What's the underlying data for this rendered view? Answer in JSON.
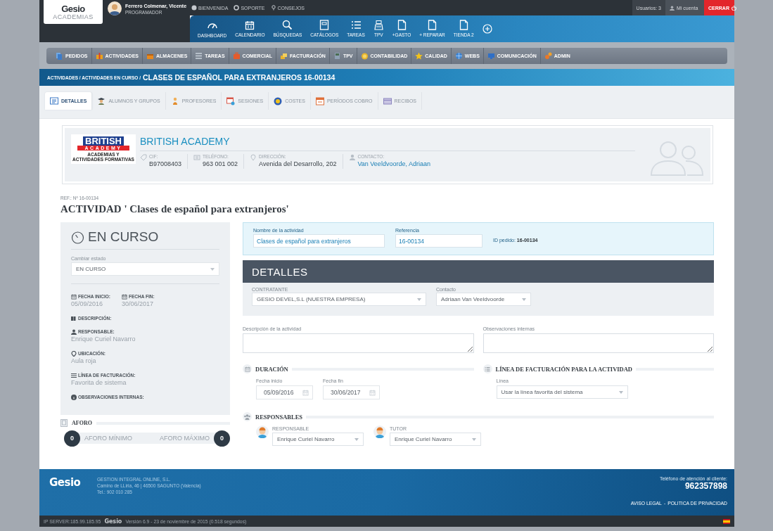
{
  "header": {
    "logo_text": "Gesio",
    "logo_sub": "ACADEMIAS",
    "user_name": "Ferrero Colmenar, Vicente",
    "user_role": "PROGRAMADOR",
    "top_links": [
      "BIENVENIDA",
      "SOPORTE",
      "CONSEJOS"
    ],
    "users": "Usuarios: 3",
    "account": "Mi cuenta",
    "logout": "CERRAR"
  },
  "toolbar": [
    {
      "label": "DASHBOARD"
    },
    {
      "label": "CALENDARIO"
    },
    {
      "label": "BÚSQUEDAS"
    },
    {
      "label": "CATÁLOGOS"
    },
    {
      "label": "TAREAS"
    },
    {
      "label": "TPV"
    },
    {
      "label": "+GASTO"
    },
    {
      "label": "+ REPARAR"
    },
    {
      "label": "TIENDA 2"
    }
  ],
  "menu": [
    {
      "label": "PEDIDOS"
    },
    {
      "label": "ACTIVIDADES"
    },
    {
      "label": "ALMACENES"
    },
    {
      "label": "TAREAS"
    },
    {
      "label": "COMERCIAL"
    },
    {
      "label": "FACTURACIÓN"
    },
    {
      "label": "TPV"
    },
    {
      "label": "CONTABILIDAD"
    },
    {
      "label": "CALIDAD"
    },
    {
      "label": "WEBS"
    },
    {
      "label": "COMUNICACIÓN"
    },
    {
      "label": "ADMIN"
    }
  ],
  "breadcrumb": {
    "path": "ACTIVIDADES / ACTIVIDADES EN CURSO /",
    "current": "CLASES DE ESPAÑOL PARA EXTRANJEROS 16-00134"
  },
  "tabs": [
    {
      "label": "DETALLES",
      "selected": true
    },
    {
      "label": "ALUMNOS Y GRUPOS",
      "selected": false
    },
    {
      "label": "PROFESORES",
      "selected": false
    },
    {
      "label": "SESIONES",
      "selected": false
    },
    {
      "label": "COSTES",
      "selected": false
    },
    {
      "label": "PERÍODOS COBRO",
      "selected": false
    },
    {
      "label": "RECIBOS",
      "selected": false
    }
  ],
  "company": {
    "logo_line1": "BRITISH",
    "logo_line2": "ACADEMY",
    "logo_tagline": "ACADEMIAS Y ACTIVIDADES FORMATIVAS",
    "name": "BRITISH ACADEMY",
    "fields": [
      {
        "label": "CIF:",
        "value": "B97008403",
        "kind": "text"
      },
      {
        "label": "TELÉFONO:",
        "value": "963 001 002",
        "kind": "text"
      },
      {
        "label": "DIRECCIÓN:",
        "value": "Avenida del Desarrollo, 202",
        "kind": "text"
      },
      {
        "label": "CONTACTO:",
        "value": "Van Veeldvoorde, Adriaan",
        "kind": "link"
      }
    ]
  },
  "activity": {
    "ref": "REF.: Nº 16-00134",
    "title": "ACTIVIDAD ' Clases de español para extranjeros'"
  },
  "status_panel": {
    "status": "EN CURSO",
    "change_label": "Cambiar estado",
    "change_value": "EN CURSO",
    "dates": [
      {
        "label": "FECHA INICIO:",
        "value": "05/09/2016"
      },
      {
        "label": "FECHA FIN:",
        "value": "30/06/2017"
      }
    ],
    "details": [
      {
        "label": "DESCRIPCIÓN:"
      },
      {
        "label": "RESPONSABLE:",
        "value": "Enrique Curiel Navarro"
      },
      {
        "label": "UBICACIÓN:",
        "value": "Aula roja"
      },
      {
        "label": "LÍNEA DE FACTURACIÓN:",
        "value": "Favorita de sistema"
      },
      {
        "label": "OBSERVACIONES INTERNAS:"
      }
    ]
  },
  "aforo": {
    "title": "AFORO",
    "min_value": "0",
    "min_label": "AFORO MÍNIMO",
    "max_label": "AFORO MÁXIMO",
    "max_value": "0"
  },
  "main_fields": {
    "name_label": "Nombre de la actividad",
    "name_value": "Clases de español para extranjeros",
    "ref_label": "Referencia",
    "ref_value": "16-00134",
    "id_label": "ID pedido:",
    "id_value": "16-00134"
  },
  "detalles": {
    "title": "DETALLES",
    "contratante_label": "CONTRATANTE",
    "contratante_value": "GESIO DEVEL,S.L (NUESTRA EMPRESA)",
    "contacto_label": "Contacto",
    "contacto_value": "Adriaan Van Veeldvoorde"
  },
  "textareas": [
    {
      "label": "Descripción de la actividad"
    },
    {
      "label": "Observaciones internas"
    }
  ],
  "duracion": {
    "title": "DURACIÓN",
    "fields": [
      {
        "label": "Fecha inicio",
        "value": "05/09/2016"
      },
      {
        "label": "Fecha fin",
        "value": "30/06/2017"
      }
    ]
  },
  "facturacion": {
    "title": "LÍNEA DE FACTURACIÓN PARA LA ACTIVIDAD",
    "label": "Línea",
    "value": "Usar la línea favorita del sistema"
  },
  "responsables": {
    "title": "RESPONSABLES",
    "people": [
      {
        "role": "RESPONSABLE",
        "value": "Enrique Curiel Navarro"
      },
      {
        "role": "TUTOR",
        "value": "Enrique Curiel Navarro"
      }
    ]
  },
  "footer": {
    "logo": "Gesio",
    "company": "GESTION INTEGRAL ONLINE, S.L.",
    "address": "Camino de LLiria, 46 | 46500 SAGUNTO (Valencia)",
    "phone": "Tel.: 902 010 285",
    "support_label": "Teléfono de atención al cliente:",
    "support_phone": "962357898",
    "legal_links": [
      "AVISO LEGAL",
      "POLITICA DE PRIVACIDAD"
    ],
    "legal_separator": "-"
  },
  "bottom_bar": {
    "server": "IP SERVER:185.99.185.95",
    "logo": "Gesio",
    "version": "Versión 6.9 - 23 de noviembre de 2015 (0.518 segundos)"
  }
}
